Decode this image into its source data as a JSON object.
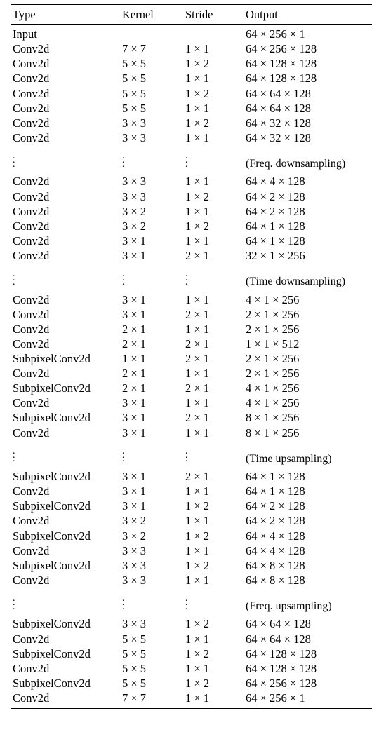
{
  "headers": {
    "type": "Type",
    "kernel": "Kernel",
    "stride": "Stride",
    "output": "Output"
  },
  "blocks": [
    {
      "rows": [
        {
          "type": "Input",
          "kernel": "",
          "stride": "",
          "output": "64 × 256 × 1"
        },
        {
          "type": "Conv2d",
          "kernel": "7 × 7",
          "stride": "1 × 1",
          "output": "64 × 256 × 128"
        },
        {
          "type": "Conv2d",
          "kernel": "5 × 5",
          "stride": "1 × 2",
          "output": "64 × 128 × 128"
        },
        {
          "type": "Conv2d",
          "kernel": "5 × 5",
          "stride": "1 × 1",
          "output": "64 × 128 × 128"
        },
        {
          "type": "Conv2d",
          "kernel": "5 × 5",
          "stride": "1 × 2",
          "output": "64 × 64 × 128"
        },
        {
          "type": "Conv2d",
          "kernel": "5 × 5",
          "stride": "1 × 1",
          "output": "64 × 64 × 128"
        },
        {
          "type": "Conv2d",
          "kernel": "3 × 3",
          "stride": "1 × 2",
          "output": "64 × 32 × 128"
        },
        {
          "type": "Conv2d",
          "kernel": "3 × 3",
          "stride": "1 × 1",
          "output": "64 × 32 × 128"
        }
      ]
    },
    {
      "dots": true,
      "annot": "(Freq. downsampling)",
      "rows": [
        {
          "type": "Conv2d",
          "kernel": "3 × 3",
          "stride": "1 × 1",
          "output": "64 × 4 × 128"
        },
        {
          "type": "Conv2d",
          "kernel": "3 × 3",
          "stride": "1 × 2",
          "output": "64 × 2 × 128"
        },
        {
          "type": "Conv2d",
          "kernel": "3 × 2",
          "stride": "1 × 1",
          "output": "64 × 2 × 128"
        },
        {
          "type": "Conv2d",
          "kernel": "3 × 2",
          "stride": "1 × 2",
          "output": "64 × 1 × 128"
        },
        {
          "type": "Conv2d",
          "kernel": "3 × 1",
          "stride": "1 × 1",
          "output": "64 × 1 × 128"
        },
        {
          "type": "Conv2d",
          "kernel": "3 × 1",
          "stride": "2 × 1",
          "output": "32 × 1 × 256"
        }
      ]
    },
    {
      "dots": true,
      "annot": "(Time downsampling)",
      "rows": [
        {
          "type": "Conv2d",
          "kernel": "3 × 1",
          "stride": "1 × 1",
          "output": "4 × 1 × 256"
        },
        {
          "type": "Conv2d",
          "kernel": "3 × 1",
          "stride": "2 × 1",
          "output": "2 × 1 × 256"
        },
        {
          "type": "Conv2d",
          "kernel": "2 × 1",
          "stride": "1 × 1",
          "output": "2 × 1 × 256"
        },
        {
          "type": "Conv2d",
          "kernel": "2 × 1",
          "stride": "2 × 1",
          "output": "1 × 1 × 512"
        },
        {
          "type": "SubpixelConv2d",
          "kernel": "1 × 1",
          "stride": "2 × 1",
          "output": "2 × 1 × 256"
        },
        {
          "type": "Conv2d",
          "kernel": "2 × 1",
          "stride": "1 × 1",
          "output": "2 × 1 × 256"
        },
        {
          "type": "SubpixelConv2d",
          "kernel": "2 × 1",
          "stride": "2 × 1",
          "output": "4 × 1 × 256"
        },
        {
          "type": "Conv2d",
          "kernel": "3 × 1",
          "stride": "1 × 1",
          "output": "4 × 1 × 256"
        },
        {
          "type": "SubpixelConv2d",
          "kernel": "3 × 1",
          "stride": "2 × 1",
          "output": "8 × 1 × 256"
        },
        {
          "type": "Conv2d",
          "kernel": "3 × 1",
          "stride": "1 × 1",
          "output": "8 × 1 × 256"
        }
      ]
    },
    {
      "dots": true,
      "annot": "(Time upsampling)",
      "rows": [
        {
          "type": "SubpixelConv2d",
          "kernel": "3 × 1",
          "stride": "2 × 1",
          "output": "64 × 1 × 128"
        },
        {
          "type": "Conv2d",
          "kernel": "3 × 1",
          "stride": "1 × 1",
          "output": "64 × 1 × 128"
        },
        {
          "type": "SubpixelConv2d",
          "kernel": "3 × 1",
          "stride": "1 × 2",
          "output": "64 × 2 × 128"
        },
        {
          "type": "Conv2d",
          "kernel": "3 × 2",
          "stride": "1 × 1",
          "output": "64 × 2 × 128"
        },
        {
          "type": "SubpixelConv2d",
          "kernel": "3 × 2",
          "stride": "1 × 2",
          "output": "64 × 4 × 128"
        },
        {
          "type": "Conv2d",
          "kernel": "3 × 3",
          "stride": "1 × 1",
          "output": "64 × 4 × 128"
        },
        {
          "type": "SubpixelConv2d",
          "kernel": "3 × 3",
          "stride": "1 × 2",
          "output": "64 × 8 × 128"
        },
        {
          "type": "Conv2d",
          "kernel": "3 × 3",
          "stride": "1 × 1",
          "output": "64 × 8 × 128"
        }
      ]
    },
    {
      "dots": true,
      "annot": "(Freq. upsampling)",
      "rows": [
        {
          "type": "SubpixelConv2d",
          "kernel": "3 × 3",
          "stride": "1 × 2",
          "output": "64 × 64 × 128"
        },
        {
          "type": "Conv2d",
          "kernel": "5 × 5",
          "stride": "1 × 1",
          "output": "64 × 64 × 128"
        },
        {
          "type": "SubpixelConv2d",
          "kernel": "5 × 5",
          "stride": "1 × 2",
          "output": "64 × 128 × 128"
        },
        {
          "type": "Conv2d",
          "kernel": "5 × 5",
          "stride": "1 × 1",
          "output": "64 × 128 × 128"
        },
        {
          "type": "SubpixelConv2d",
          "kernel": "5 × 5",
          "stride": "1 × 2",
          "output": "64 × 256 × 128"
        },
        {
          "type": "Conv2d",
          "kernel": "7 × 7",
          "stride": "1 × 1",
          "output": "64 × 256 × 1"
        }
      ]
    }
  ]
}
